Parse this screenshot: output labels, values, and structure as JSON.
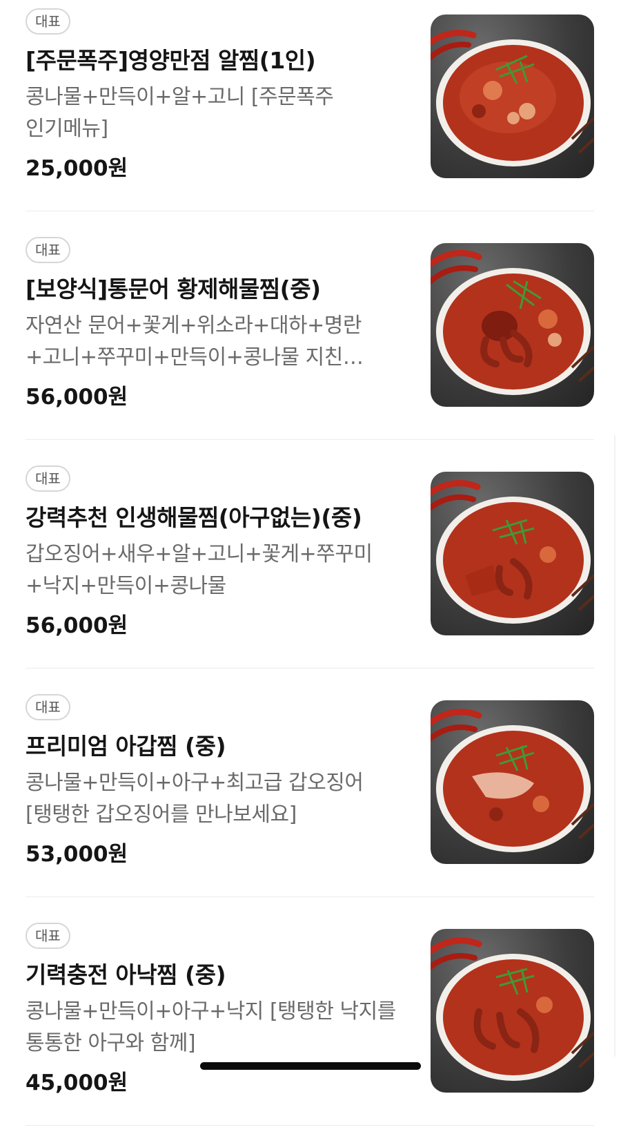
{
  "menu": {
    "items": [
      {
        "badge": "대표",
        "name": "[주문폭주]영양만점 알찜(1인)",
        "description": "콩나물+만득이+알+고니 [주문폭주 인기메뉴]",
        "price": "25,000원",
        "image_icon": "seafood-stew-photo"
      },
      {
        "badge": "대표",
        "name": "[보양식]통문어 황제해물찜(중)",
        "description": "자연산 문어+꽃게+위소라+대하+명란+고니+쭈꾸미+만득이+콩나물 지친 당신에게 보양식을",
        "price": "56,000원",
        "image_icon": "octopus-stew-photo"
      },
      {
        "badge": "대표",
        "name": "강력추천 인생해물찜(아구없는)(중)",
        "description": "갑오징어+새우+알+고니+꽃게+쭈꾸미+낙지+만득이+콩나물",
        "price": "56,000원",
        "image_icon": "seafood-stew-photo"
      },
      {
        "badge": "대표",
        "name": "프리미엄 아갑찜 (중)",
        "description": "콩나물+만득이+아구+최고급 갑오징어 [탱탱한 갑오징어를 만나보세요]",
        "price": "53,000원",
        "image_icon": "seafood-stew-photo"
      },
      {
        "badge": "대표",
        "name": "기력충전 아낙찜 (중)",
        "description": "콩나물+만득이+아구+낙지 [탱탱한 낙지를 통통한 아구와 함께]",
        "price": "45,000원",
        "image_icon": "octopus-stew-photo"
      }
    ]
  },
  "colors": {
    "stew_red": "#b3321c",
    "bowl_white": "#f2efea",
    "herb_green": "#3f9a36",
    "chili_red": "#c0261a"
  }
}
